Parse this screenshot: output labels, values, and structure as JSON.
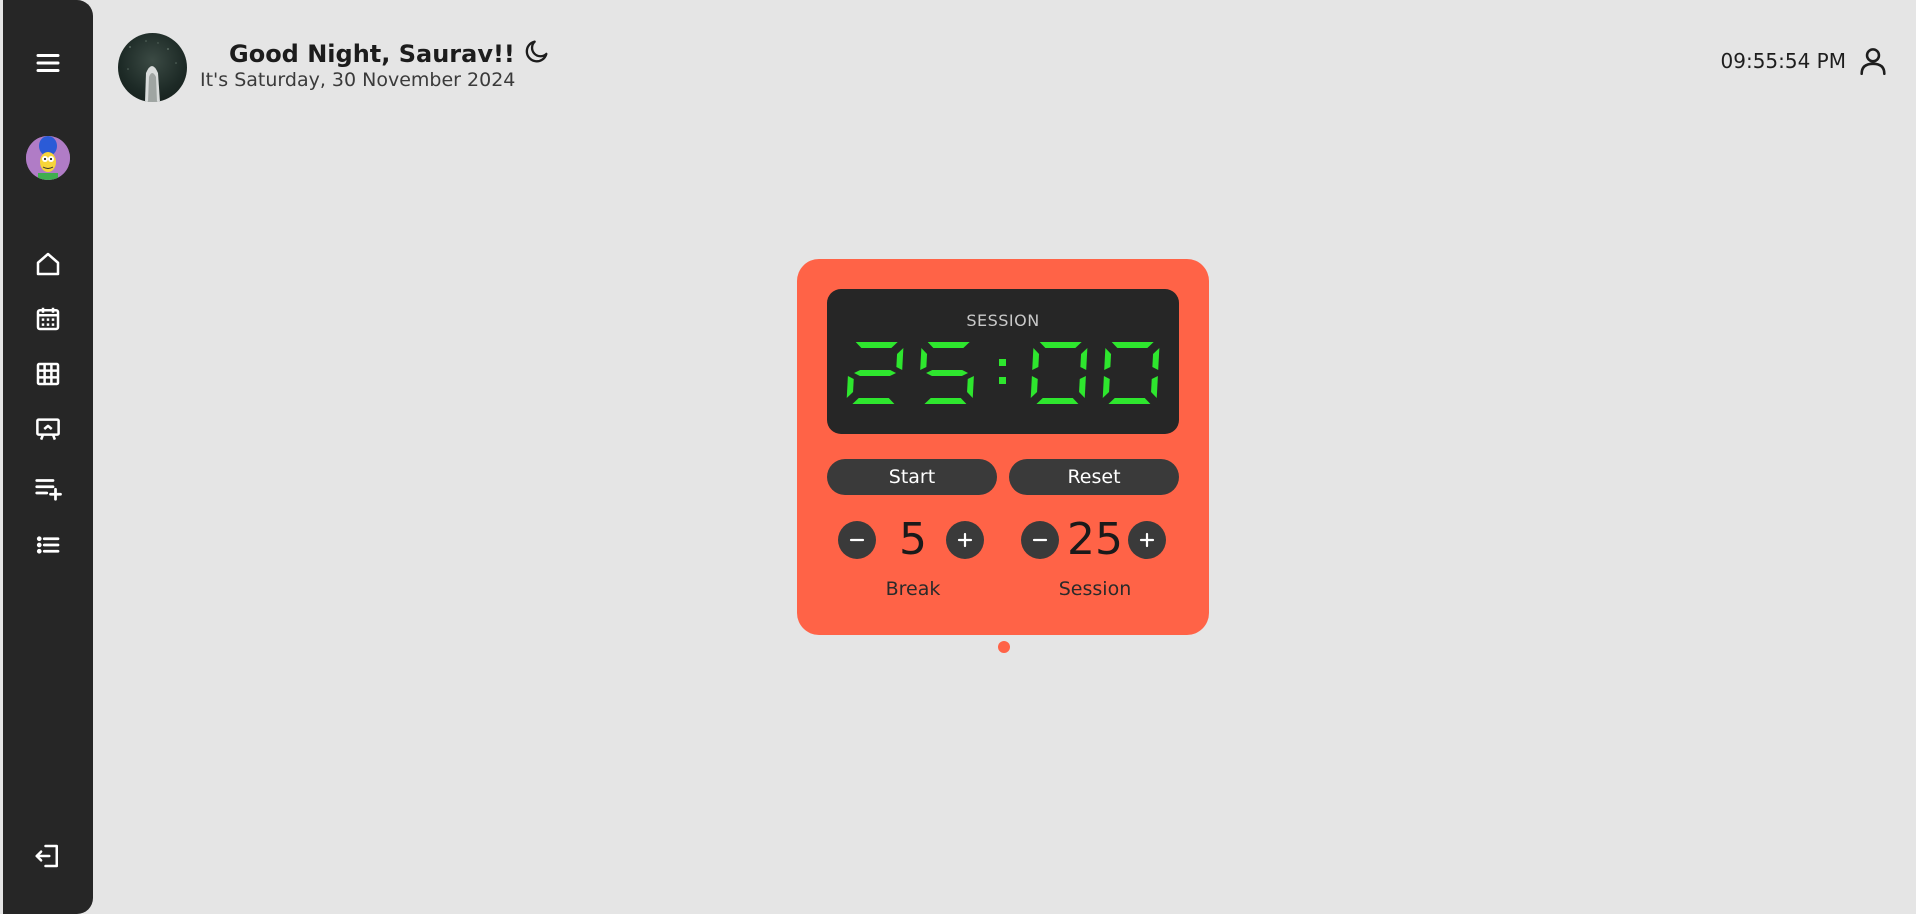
{
  "header": {
    "greeting": "Good Night, Saurav!!",
    "date_line": "It's Saturday, 30 November 2024",
    "clock": "09:55:54 PM"
  },
  "sidebar": {
    "items": [
      {
        "icon": "menu-icon"
      },
      {
        "icon": "avatar"
      },
      {
        "icon": "home-icon"
      },
      {
        "icon": "calendar-icon"
      },
      {
        "icon": "grid-icon"
      },
      {
        "icon": "presentation-icon"
      },
      {
        "icon": "playlist-add-icon"
      },
      {
        "icon": "list-icon"
      },
      {
        "icon": "logout-icon"
      }
    ]
  },
  "timer": {
    "mode_label": "SESSION",
    "display": "25:00",
    "start_label": "Start",
    "reset_label": "Reset",
    "break_value": "5",
    "break_label": "Break",
    "session_value": "25",
    "session_label": "Session",
    "digit_color": "#2ee62e"
  },
  "colors": {
    "accent": "#ff6347",
    "sidebar": "#262626",
    "background": "#e5e5e5"
  }
}
